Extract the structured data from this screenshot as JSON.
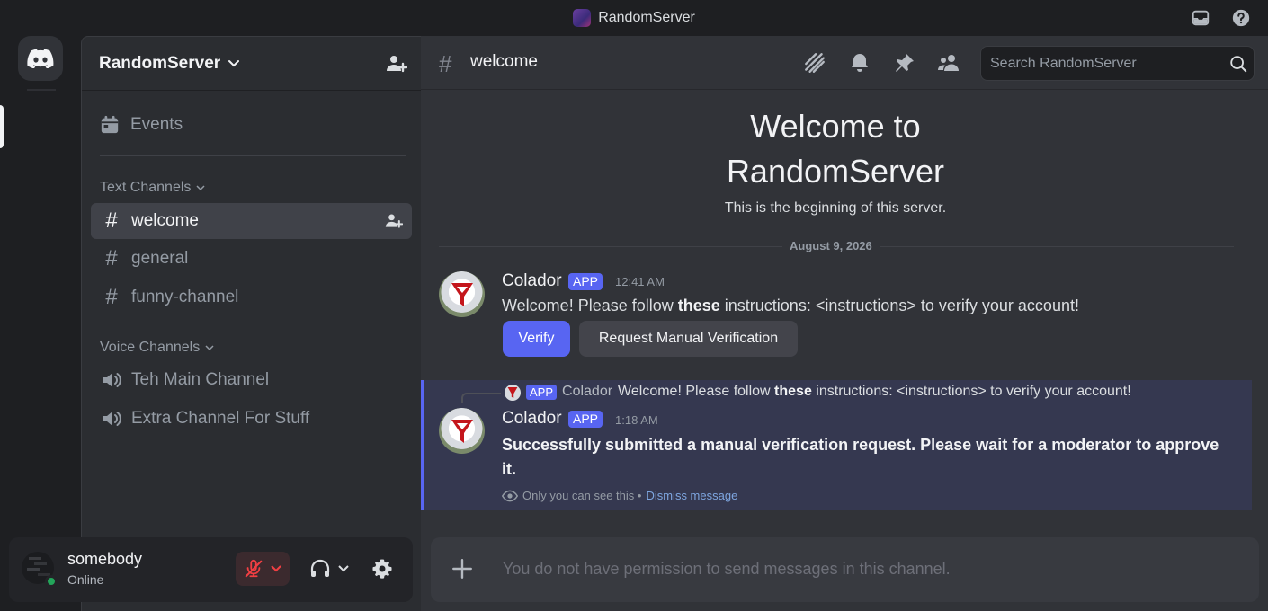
{
  "window": {
    "title": "RandomServer"
  },
  "titlebar": {
    "icons": [
      "inbox-icon",
      "help-icon"
    ]
  },
  "server": {
    "name": "RandomServer"
  },
  "sidebar": {
    "events_label": "Events",
    "text_category": "Text Channels",
    "text_channels": [
      {
        "name": "welcome",
        "active": true
      },
      {
        "name": "general",
        "active": false
      },
      {
        "name": "funny-channel",
        "active": false
      }
    ],
    "voice_category": "Voice Channels",
    "voice_channels": [
      {
        "name": "Teh Main Channel"
      },
      {
        "name": "Extra Channel For Stuff"
      }
    ]
  },
  "user": {
    "name": "somebody",
    "status": "Online",
    "status_color": "#23a55a"
  },
  "channel": {
    "name": "welcome",
    "search_placeholder": "Search RandomServer"
  },
  "welcome": {
    "title_line1": "Welcome to",
    "title_line2": "RandomServer",
    "subtitle": "This is the beginning of this server."
  },
  "date_divider": "August 9, 2026",
  "messages": [
    {
      "author": "Colador",
      "badge": "APP",
      "time": "12:41 AM",
      "text_before": "Welcome! Please follow ",
      "text_bold": "these",
      "text_after": " instructions: <instructions> to verify your account!",
      "buttons": [
        "Verify",
        "Request Manual Verification"
      ]
    },
    {
      "reply": {
        "badge": "APP",
        "author": "Colador",
        "text_before": "Welcome! Please follow ",
        "text_bold": "these",
        "text_after": " instructions: <instructions> to verify your account!"
      },
      "author": "Colador",
      "badge": "APP",
      "time": "1:18 AM",
      "text": "Successfully submitted a manual verification request. Please wait for a moderator to approve it.",
      "ephemeral_note": "Only you can see this • ",
      "dismiss_label": "Dismiss message"
    }
  ],
  "composer": {
    "placeholder": "You do not have permission to send messages in this channel."
  },
  "colors": {
    "accent": "#5865f2",
    "mute_red": "#f23f43"
  }
}
